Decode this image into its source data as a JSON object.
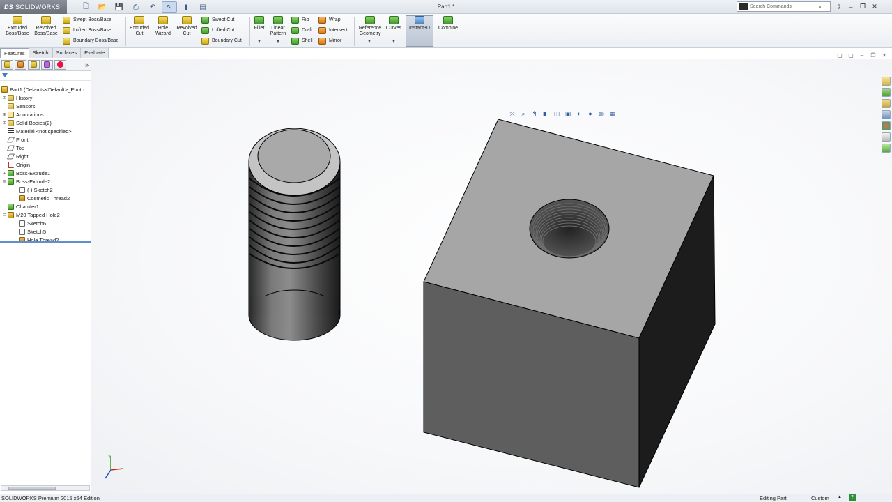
{
  "titlebar": {
    "logo": "SOLIDWORKS",
    "logo_mark": "DS",
    "document_title": "Part1 *",
    "search_placeholder": "Search Commands"
  },
  "command_manager": {
    "extruded_boss": "Extruded Boss/Base",
    "revolved_boss": "Revolved Boss/Base",
    "swept_boss": "Swept Boss/Base",
    "lofted_boss": "Lofted Boss/Base",
    "boundary_boss": "Boundary Boss/Base",
    "extruded_cut": "Extruded Cut",
    "hole_wizard": "Hole Wizard",
    "revolved_cut": "Revolved Cut",
    "swept_cut": "Swept Cut",
    "lofted_cut": "Lofted Cut",
    "boundary_cut": "Boundary Cut",
    "fillet": "Fillet",
    "linear_pattern": "Linear Pattern",
    "rib": "Rib",
    "draft": "Draft",
    "shell": "Shell",
    "wrap": "Wrap",
    "intersect": "Intersect",
    "mirror": "Mirror",
    "reference_geometry": "Reference Geometry",
    "curves": "Curves",
    "instant3d": "Instant3D",
    "combine": "Combine"
  },
  "tabs": [
    "Features",
    "Sketch",
    "Surfaces",
    "Evaluate"
  ],
  "active_tab": "Features",
  "feature_tree": [
    {
      "label": "Part1  (Default<<Default>_Photo",
      "icon": "part-icon"
    },
    {
      "label": "History",
      "icon": "history-icon"
    },
    {
      "label": "Sensors",
      "icon": "sensors-icon"
    },
    {
      "label": "Annotations",
      "icon": "annotations-icon"
    },
    {
      "label": "Solid Bodies(2)",
      "icon": "solid-bodies-icon"
    },
    {
      "label": "Material <not specified>",
      "icon": "material-icon"
    },
    {
      "label": "Front",
      "icon": "plane-icon"
    },
    {
      "label": "Top",
      "icon": "plane-icon"
    },
    {
      "label": "Right",
      "icon": "plane-icon"
    },
    {
      "label": "Origin",
      "icon": "origin-icon"
    },
    {
      "label": "Boss-Extrude1",
      "icon": "extrude-icon"
    },
    {
      "label": "Boss-Extrude2",
      "icon": "extrude-icon"
    },
    {
      "label": "(-) Sketch2",
      "icon": "sketch-icon"
    },
    {
      "label": "Cosmetic Thread2",
      "icon": "thread-icon"
    },
    {
      "label": "Chamfer1",
      "icon": "chamfer-icon"
    },
    {
      "label": "M20 Tapped Hole2",
      "icon": "hole-icon"
    },
    {
      "label": "Sketch6",
      "icon": "sketch-icon"
    },
    {
      "label": "Sketch5",
      "icon": "sketch-icon"
    },
    {
      "label": "Hole Thread2",
      "icon": "thread-icon"
    }
  ],
  "statusbar": {
    "product": "SOLIDWORKS Premium 2015 x64 Edition",
    "mode": "Editing Part",
    "units": "Custom",
    "help": "?"
  },
  "colors": {
    "face_top": "#a6a6a6",
    "face_front": "#5e5e5e",
    "face_side": "#1c1c1c",
    "accent_blue": "#3f7dc8"
  }
}
